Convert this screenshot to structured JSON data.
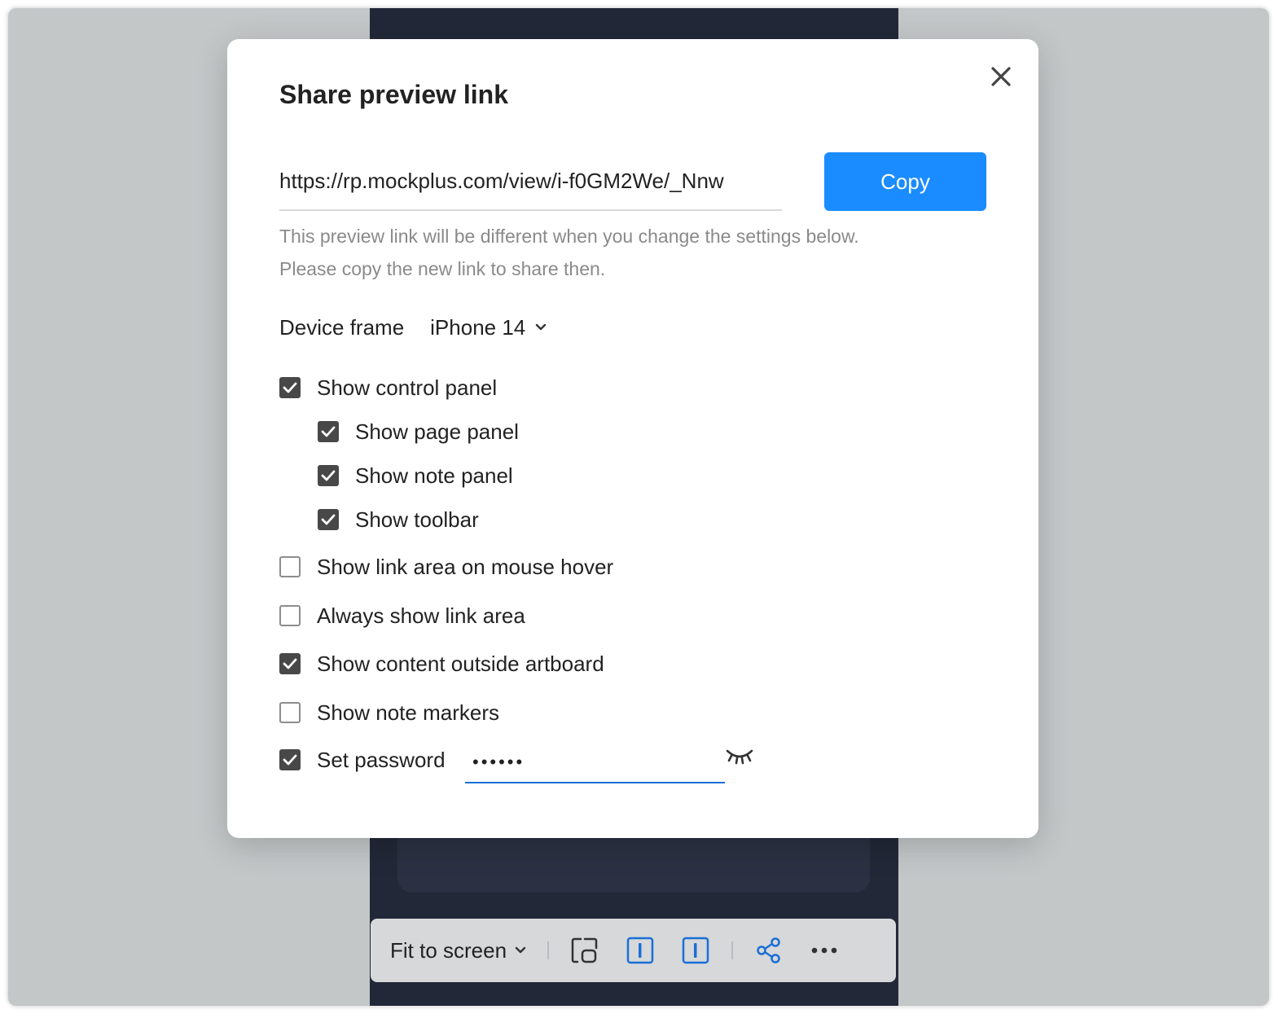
{
  "modal": {
    "title": "Share preview link",
    "link": "https://rp.mockplus.com/view/i-f0GM2We/_Nnw",
    "copy_label": "Copy",
    "hint_line1": "This preview link will be different when you change the settings below.",
    "hint_line2": "Please copy the new link to share then.",
    "device_label": "Device frame",
    "device_value": "iPhone 14",
    "options": {
      "control_panel": {
        "label": "Show control panel",
        "checked": true
      },
      "page_panel": {
        "label": "Show page panel",
        "checked": true
      },
      "note_panel": {
        "label": "Show note panel",
        "checked": true
      },
      "toolbar": {
        "label": "Show toolbar",
        "checked": true
      },
      "link_area_hover": {
        "label": "Show link area on mouse hover",
        "checked": false
      },
      "always_link_area": {
        "label": "Always show link area",
        "checked": false
      },
      "content_outside": {
        "label": "Show content outside artboard",
        "checked": true
      },
      "note_markers": {
        "label": "Show note markers",
        "checked": false
      },
      "set_password": {
        "label": "Set password",
        "checked": true
      }
    },
    "password_value": "••••••"
  },
  "toolbar": {
    "zoom_label": "Fit to screen",
    "icons": [
      "fit-frame-icon",
      "left-panel-icon",
      "right-panel-icon",
      "share-icon",
      "more-icon"
    ]
  },
  "colors": {
    "accent": "#1a8cff",
    "checkbox_on": "#484848",
    "backdrop": "#c3c7c8",
    "canvas": "#232838"
  }
}
